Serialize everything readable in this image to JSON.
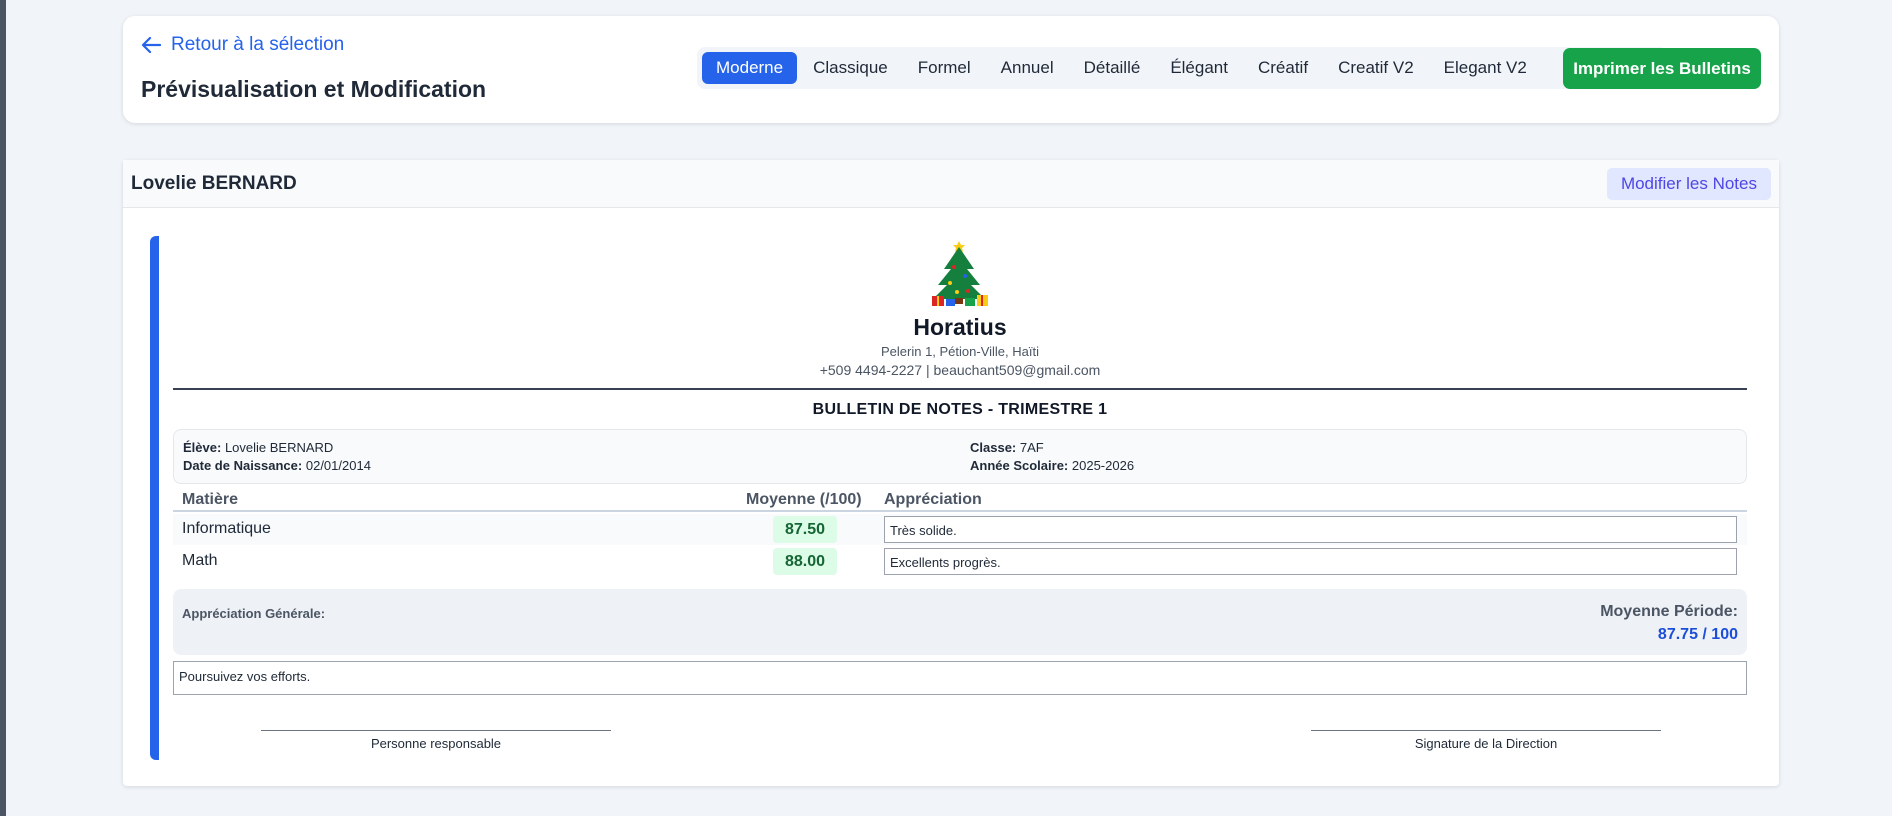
{
  "header": {
    "back_label": "Retour à la sélection",
    "title": "Prévisualisation et Modification",
    "tabs": [
      {
        "label": "Moderne",
        "active": true
      },
      {
        "label": "Classique"
      },
      {
        "label": "Formel"
      },
      {
        "label": "Annuel"
      },
      {
        "label": "Détaillé"
      },
      {
        "label": "Élégant"
      },
      {
        "label": "Créatif"
      },
      {
        "label": "Creatif V2"
      },
      {
        "label": "Elegant V2"
      }
    ],
    "print_label": "Imprimer les Bulletins"
  },
  "student_card": {
    "name": "Lovelie BERNARD",
    "edit_label": "Modifier les Notes"
  },
  "report": {
    "logo_icon": "christmas-tree-icon",
    "school_name": "Horatius",
    "school_address": "Pelerin 1, Pétion-Ville, Haïti",
    "school_contact": "+509 4494-2227 | beauchant509@gmail.com",
    "bulletin_title": "BULLETIN DE NOTES - TRIMESTRE 1",
    "info": {
      "student_label": "Élève:",
      "student_value": "Lovelie BERNARD",
      "dob_label": "Date de Naissance:",
      "dob_value": "02/01/2014",
      "class_label": "Classe:",
      "class_value": "7AF",
      "year_label": "Année Scolaire:",
      "year_value": "2025-2026"
    },
    "columns": {
      "subject": "Matière",
      "average": "Moyenne (/100)",
      "appreciation": "Appréciation"
    },
    "grades": [
      {
        "subject": "Informatique",
        "score": "87.50",
        "appreciation": "Très solide."
      },
      {
        "subject": "Math",
        "score": "88.00",
        "appreciation": "Excellents progrès."
      }
    ],
    "general_label": "Appréciation Générale:",
    "period_avg_label": "Moyenne Période:",
    "period_avg_value": "87.75 / 100",
    "general_appreciation": "Poursuivez vos efforts.",
    "signature_left": "Personne responsable",
    "signature_right": "Signature de la Direction"
  },
  "colors": {
    "primary": "#2563eb",
    "print_button": "#16a34a",
    "score_bg": "#dcfce7",
    "score_text": "#166534"
  }
}
